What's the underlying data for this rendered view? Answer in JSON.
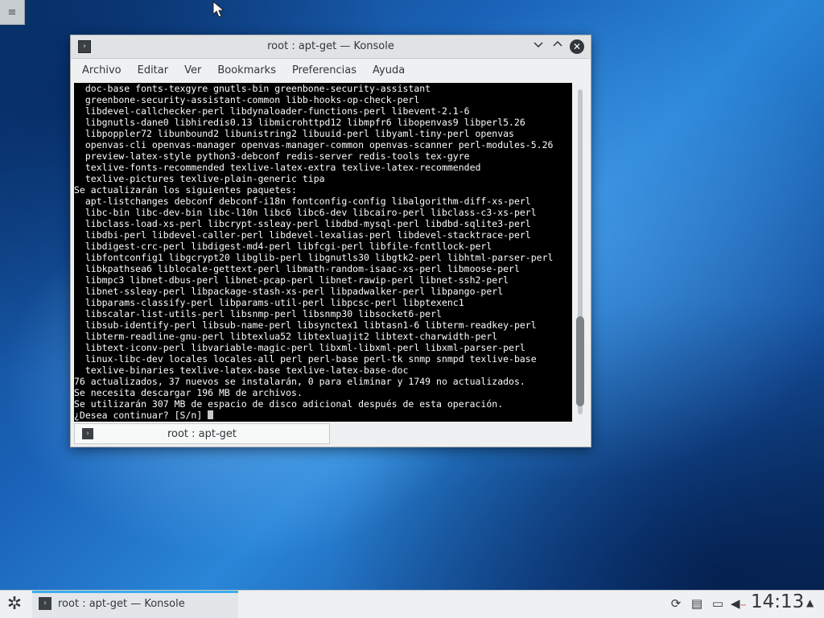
{
  "window": {
    "title": "root : apt-get — Konsole",
    "icons": {
      "app": "terminal-icon",
      "minimize": "chevron-down-icon",
      "maximize": "chevron-up-icon",
      "close": "close-icon"
    }
  },
  "menubar": {
    "items": [
      "Archivo",
      "Editar",
      "Ver",
      "Bookmarks",
      "Preferencias",
      "Ayuda"
    ]
  },
  "terminal": {
    "lines": [
      "  doc-base fonts-texgyre gnutls-bin greenbone-security-assistant",
      "  greenbone-security-assistant-common libb-hooks-op-check-perl",
      "  libdevel-callchecker-perl libdynaloader-functions-perl libevent-2.1-6",
      "  libgnutls-dane0 libhiredis0.13 libmicrohttpd12 libmpfr6 libopenvas9 libperl5.26",
      "  libpoppler72 libunbound2 libunistring2 libuuid-perl libyaml-tiny-perl openvas",
      "  openvas-cli openvas-manager openvas-manager-common openvas-scanner perl-modules-5.26",
      "  preview-latex-style python3-debconf redis-server redis-tools tex-gyre",
      "  texlive-fonts-recommended texlive-latex-extra texlive-latex-recommended",
      "  texlive-pictures texlive-plain-generic tipa",
      "Se actualizarán los siguientes paquetes:",
      "  apt-listchanges debconf debconf-i18n fontconfig-config libalgorithm-diff-xs-perl",
      "  libc-bin libc-dev-bin libc-l10n libc6 libc6-dev libcairo-perl libclass-c3-xs-perl",
      "  libclass-load-xs-perl libcrypt-ssleay-perl libdbd-mysql-perl libdbd-sqlite3-perl",
      "  libdbi-perl libdevel-caller-perl libdevel-lexalias-perl libdevel-stacktrace-perl",
      "  libdigest-crc-perl libdigest-md4-perl libfcgi-perl libfile-fcntllock-perl",
      "  libfontconfig1 libgcrypt20 libglib-perl libgnutls30 libgtk2-perl libhtml-parser-perl",
      "  libkpathsea6 liblocale-gettext-perl libmath-random-isaac-xs-perl libmoose-perl",
      "  libmpc3 libnet-dbus-perl libnet-pcap-perl libnet-rawip-perl libnet-ssh2-perl",
      "  libnet-ssleay-perl libpackage-stash-xs-perl libpadwalker-perl libpango-perl",
      "  libparams-classify-perl libparams-util-perl libpcsc-perl libptexenc1",
      "  libscalar-list-utils-perl libsnmp-perl libsnmp30 libsocket6-perl",
      "  libsub-identify-perl libsub-name-perl libsynctex1 libtasn1-6 libterm-readkey-perl",
      "  libterm-readline-gnu-perl libtexlua52 libtexluajit2 libtext-charwidth-perl",
      "  libtext-iconv-perl libvariable-magic-perl libxml-libxml-perl libxml-parser-perl",
      "  linux-libc-dev locales locales-all perl perl-base perl-tk snmp snmpd texlive-base",
      "  texlive-binaries texlive-latex-base texlive-latex-base-doc",
      "76 actualizados, 37 nuevos se instalarán, 0 para eliminar y 1749 no actualizados.",
      "Se necesita descargar 196 MB de archivos.",
      "Se utilizarán 307 MB de espacio de disco adicional después de esta operación.",
      "¿Desea continuar? [S/n] "
    ],
    "scroll_position": 0.72
  },
  "tab": {
    "label": "root : apt-get",
    "icon": "terminal-icon"
  },
  "taskbar": {
    "launcher_icon": "kde-logo-icon",
    "task_label": "root : apt-get — Konsole",
    "tray_icons": [
      "updates-icon",
      "clipboard-icon",
      "network-icon",
      "volume-muted-icon"
    ],
    "clock": "14:13"
  },
  "colors": {
    "accent": "#3daee9",
    "terminal_bg": "#000000",
    "terminal_fg": "#fcfcfc",
    "window_bg": "#eff0f1"
  }
}
